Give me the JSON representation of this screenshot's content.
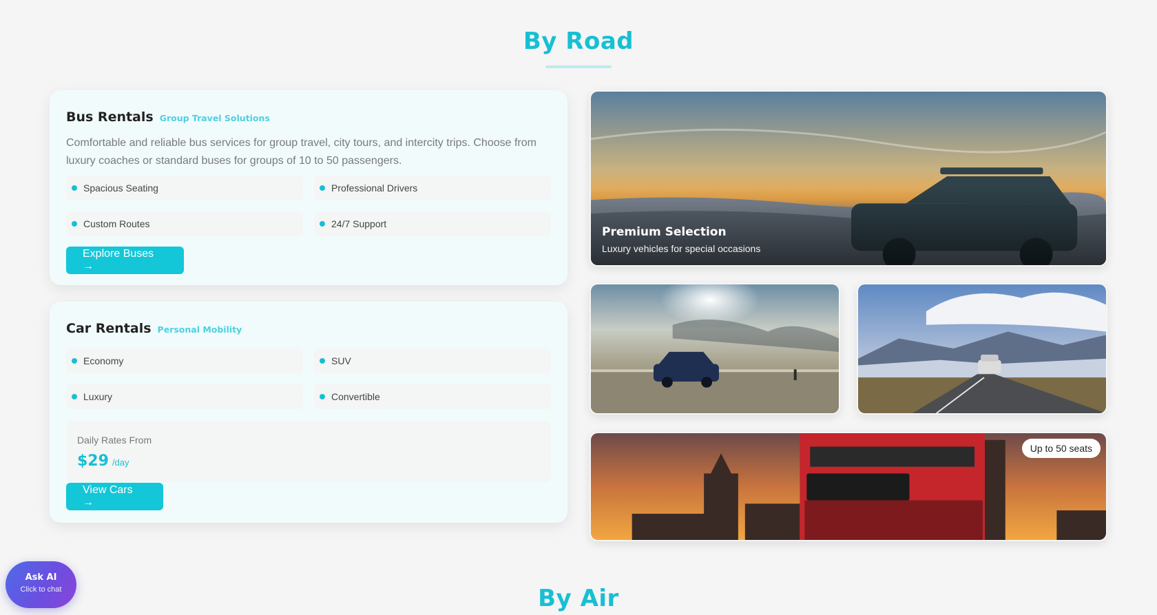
{
  "sections": {
    "road_title": "By Road",
    "air_title": "By Air"
  },
  "bus": {
    "title": "Bus Rentals",
    "subtitle": "Group Travel Solutions",
    "description": "Comfortable and reliable bus services for group travel, city tours, and intercity trips. Choose from luxury coaches or standard buses for groups of 10 to 50 passengers.",
    "features": [
      "Spacious Seating",
      "Professional Drivers",
      "Custom Routes",
      "24/7 Support"
    ],
    "button": "Explore Buses →"
  },
  "car": {
    "title": "Car Rentals",
    "subtitle": "Personal Mobility",
    "features": [
      "Economy",
      "SUV",
      "Luxury",
      "Convertible"
    ],
    "rates_label": "Daily Rates From",
    "rates_amount": "$29",
    "rates_unit": "/day",
    "button": "View Cars →"
  },
  "gallery": {
    "premium_title": "Premium Selection",
    "premium_subtitle": "Luxury vehicles for special occasions",
    "bus_badge": "Up to 50 seats"
  },
  "ask_ai": {
    "label": "Ask AI",
    "sublabel": "Click to chat"
  },
  "colors": {
    "accent": "#17bfd3",
    "background": "#f5f5f5",
    "card": "#f1fbfc"
  }
}
